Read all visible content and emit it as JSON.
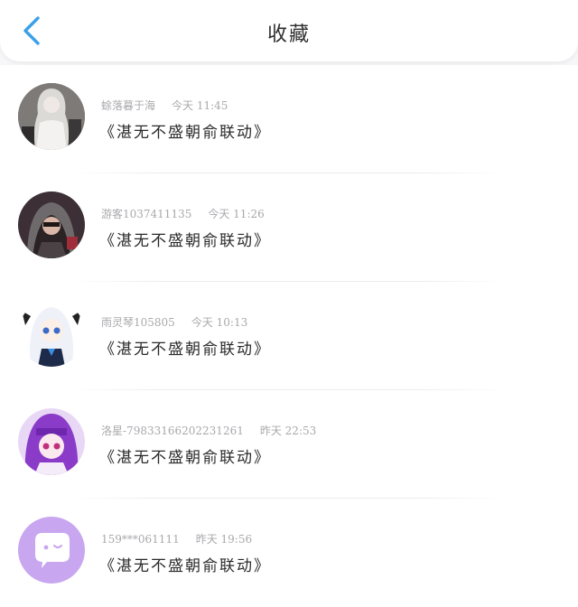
{
  "header": {
    "title": "收藏",
    "back_icon": "chevron-left-icon",
    "accent": "#3aa0e8"
  },
  "items": [
    {
      "user": "蜍落暮于海",
      "time": "今天 11:45",
      "content": "《湛无不盛朝俞联动》",
      "avatar": "girl-white-dress"
    },
    {
      "user": "游客1037411135",
      "time": "今天 11:26",
      "content": "《湛无不盛朝俞联动》",
      "avatar": "hooded-person"
    },
    {
      "user": "雨灵琴105805",
      "time": "今天 10:13",
      "content": "《湛无不盛朝俞联动》",
      "avatar": "anime-white-hair"
    },
    {
      "user": "洛星-79833166202231261",
      "time": "昨天 22:53",
      "content": "《湛无不盛朝俞联动》",
      "avatar": "anime-purple-hair"
    },
    {
      "user": "159***061111",
      "time": "昨天 19:56",
      "content": "《湛无不盛朝俞联动》",
      "avatar": "default-chat-icon",
      "avatar_color": "#c9a6f0"
    }
  ]
}
